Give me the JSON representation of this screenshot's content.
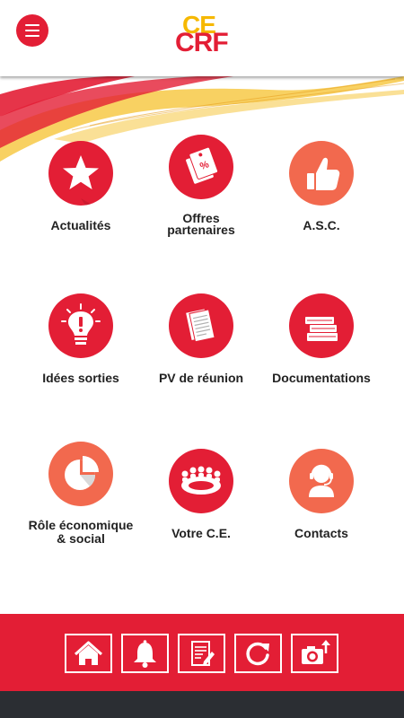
{
  "header": {
    "logo_top": "CE",
    "logo_bottom": "CRF",
    "menu_icon": "hamburger-icon"
  },
  "tiles": [
    {
      "label": "Actualités",
      "icon": "star-icon",
      "color": "#e31e35"
    },
    {
      "label_line1": "Offres",
      "label_line2": "partenaires",
      "icon": "price-tags-icon",
      "color": "#e31e35"
    },
    {
      "label": "A.S.C.",
      "icon": "thumbs-up-icon",
      "color": "#f2694e"
    },
    {
      "label": "Idées sorties",
      "icon": "lightbulb-icon",
      "color": "#e31e35"
    },
    {
      "label": "PV de réunion",
      "icon": "documents-icon",
      "color": "#e31e35"
    },
    {
      "label": "Documentations",
      "icon": "books-icon",
      "color": "#e31e35"
    },
    {
      "label_line1": "Rôle économique",
      "label_line2": "& social",
      "icon": "pie-chart-icon",
      "color": "#f2694e"
    },
    {
      "label": "Votre C.E.",
      "icon": "meeting-table-icon",
      "color": "#e31e35"
    },
    {
      "label": "Contacts",
      "icon": "headset-operator-icon",
      "color": "#f2694e"
    }
  ],
  "footer": {
    "buttons": [
      "home-icon",
      "bell-icon",
      "edit-document-icon",
      "refresh-icon",
      "camera-upload-icon"
    ],
    "color": "#e31e35"
  },
  "colors": {
    "accent": "#e31e35",
    "secondary": "#f2694e",
    "logo_yellow": "#f6b800"
  }
}
